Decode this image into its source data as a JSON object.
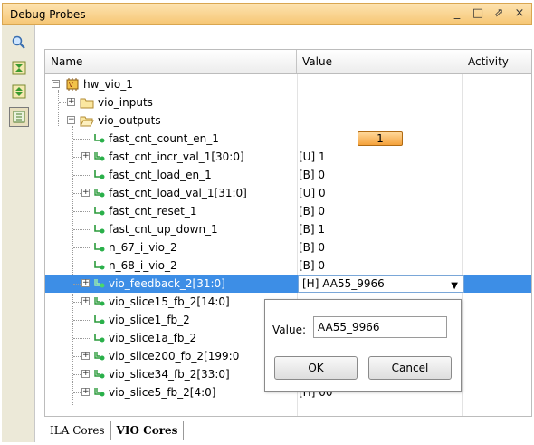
{
  "window": {
    "title": "Debug Probes",
    "buttons": [
      "minimize-icon",
      "maximize-icon",
      "restore-icon",
      "close-icon"
    ]
  },
  "sidebar": {
    "icons": [
      "search-icon",
      "collapse-all-icon",
      "expand-all-icon",
      "hierarchy-icon"
    ]
  },
  "columns": {
    "name": "Name",
    "value": "Value",
    "activity": "Activity"
  },
  "tree": {
    "root": "hw_vio_1",
    "inputs": "vio_inputs",
    "outputs": "vio_outputs"
  },
  "probes": [
    {
      "name": "fast_cnt_count_en_1",
      "value": "1"
    },
    {
      "name": "fast_cnt_incr_val_1[30:0]",
      "value": "[U] 1"
    },
    {
      "name": "fast_cnt_load_en_1",
      "value": "[B] 0"
    },
    {
      "name": "fast_cnt_load_val_1[31:0]",
      "value": "[U] 0"
    },
    {
      "name": "fast_cnt_reset_1",
      "value": "[B] 0"
    },
    {
      "name": "fast_cnt_up_down_1",
      "value": "[B] 1"
    },
    {
      "name": "n_67_i_vio_2",
      "value": "[B] 0"
    },
    {
      "name": "n_68_i_vio_2",
      "value": "[B] 0"
    },
    {
      "name": "vio_feedback_2[31:0]",
      "value": "[H] AA55_9966"
    },
    {
      "name": "vio_slice15_fb_2[14:0]",
      "value": ""
    },
    {
      "name": "vio_slice1_fb_2",
      "value": ""
    },
    {
      "name": "vio_slice1a_fb_2",
      "value": ""
    },
    {
      "name": "vio_slice200_fb_2[199:0",
      "value": ""
    },
    {
      "name": "vio_slice34_fb_2[33:0]",
      "value": ""
    },
    {
      "name": "vio_slice5_fb_2[4:0]",
      "value": "[H] 00"
    }
  ],
  "popup": {
    "value_label": "Value:",
    "value": "AA55_9966",
    "ok": "OK",
    "cancel": "Cancel"
  },
  "tabs": [
    "ILA Cores",
    "VIO Cores"
  ],
  "colors": {
    "title_bar": "#f6c674",
    "selection": "#3d8ee6",
    "toggle": "#f4a13a"
  }
}
